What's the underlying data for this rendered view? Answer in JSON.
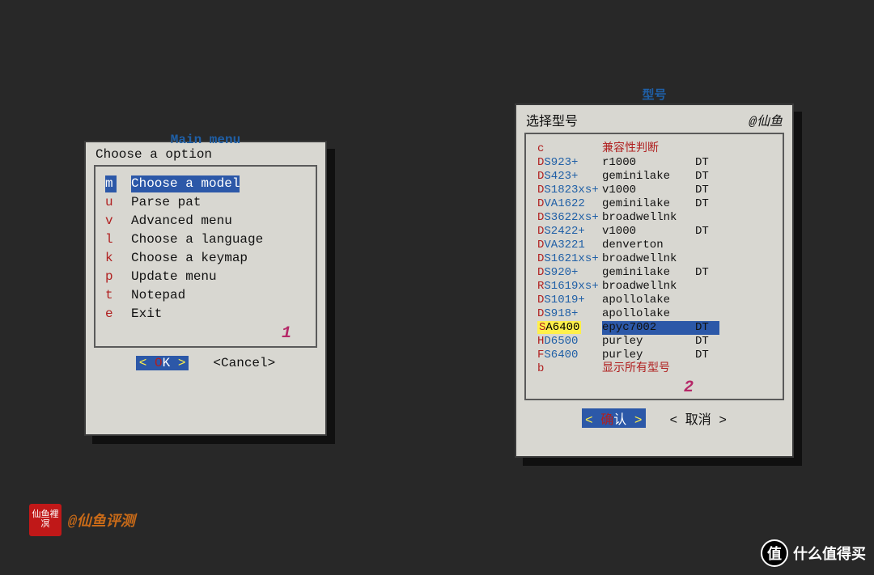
{
  "dialog1": {
    "title": "Main menu",
    "subtitle": "Choose a option",
    "items": [
      {
        "hotkey": "m",
        "label": "Choose a model",
        "selected": true
      },
      {
        "hotkey": "u",
        "label": "Parse pat"
      },
      {
        "hotkey": "v",
        "label": "Advanced menu"
      },
      {
        "hotkey": "l",
        "label": "Choose a language"
      },
      {
        "hotkey": "k",
        "label": "Choose a keymap"
      },
      {
        "hotkey": "p",
        "label": "Update menu"
      },
      {
        "hotkey": "t",
        "label": "Notepad"
      },
      {
        "hotkey": "e",
        "label": "Exit"
      }
    ],
    "number": "1",
    "ok": "OK",
    "cancel": "<Cancel>"
  },
  "dialog2": {
    "outer_title": "型号",
    "subtitle": "选择型号",
    "author": "@仙鱼",
    "header": {
      "key": "c",
      "label": "兼容性判断"
    },
    "items": [
      {
        "k": "DS923+",
        "arch": "r1000",
        "dt": "DT"
      },
      {
        "k": "DS423+",
        "arch": "geminilake",
        "dt": "DT"
      },
      {
        "k": "DS1823xs+",
        "arch": "v1000",
        "dt": "DT"
      },
      {
        "k": "DVA1622",
        "arch": "geminilake",
        "dt": "DT"
      },
      {
        "k": "DS3622xs+",
        "arch": "broadwellnk",
        "dt": ""
      },
      {
        "k": "DS2422+",
        "arch": "v1000",
        "dt": "DT"
      },
      {
        "k": "DVA3221",
        "arch": "denverton",
        "dt": ""
      },
      {
        "k": "DS1621xs+",
        "arch": "broadwellnk",
        "dt": ""
      },
      {
        "k": "DS920+",
        "arch": "geminilake",
        "dt": "DT"
      },
      {
        "k": "RS1619xs+",
        "arch": "broadwellnk",
        "dt": ""
      },
      {
        "k": "DS1019+",
        "arch": "apollolake",
        "dt": ""
      },
      {
        "k": "DS918+",
        "arch": "apollolake",
        "dt": ""
      },
      {
        "k": "SA6400",
        "arch": "epyc7002",
        "dt": "DT",
        "selected": true
      },
      {
        "k": "HD6500",
        "arch": "purley",
        "dt": "DT"
      },
      {
        "k": "FS6400",
        "arch": "purley",
        "dt": "DT"
      }
    ],
    "footer": {
      "key": "b",
      "label": "显示所有型号"
    },
    "number": "2",
    "ok": "确认",
    "cancel": "< 取消 >"
  },
  "watermark": {
    "seal": "仙鱼裡凕",
    "text": "@仙鱼评测"
  },
  "corner": "什么值得买"
}
